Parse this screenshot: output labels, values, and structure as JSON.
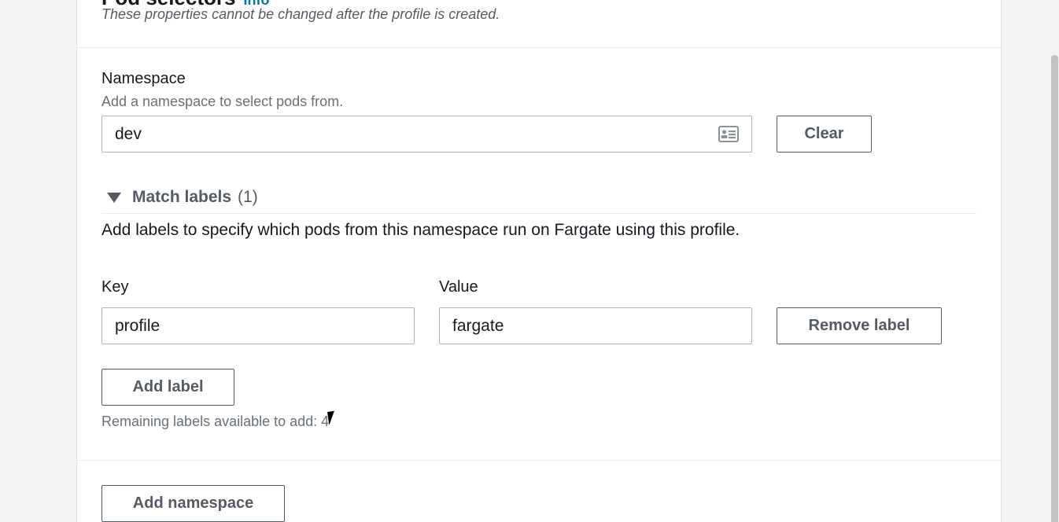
{
  "section": {
    "title": "Pod selectors",
    "info_link": "Info",
    "description": "These properties cannot be changed after the profile is created."
  },
  "namespace": {
    "label": "Namespace",
    "hint": "Add a namespace to select pods from.",
    "value": "dev",
    "input_icon": "contact-card-icon",
    "clear_button": "Clear"
  },
  "match_labels": {
    "title": "Match labels",
    "count": "(1)",
    "expanded": true,
    "description": "Add labels to specify which pods from this namespace run on Fargate using this profile.",
    "key_label": "Key",
    "value_label": "Value",
    "rows": [
      {
        "key": "profile",
        "value": "fargate",
        "remove_button": "Remove label"
      }
    ],
    "add_button": "Add label",
    "remaining_text": "Remaining labels available to add: 4"
  },
  "add_namespace_button": "Add namespace",
  "colors": {
    "accent_link": "#0073bb",
    "text_primary": "#16191f",
    "text_secondary": "#687078",
    "button_border": "#545b64",
    "page_bg": "#f2f3f3"
  }
}
